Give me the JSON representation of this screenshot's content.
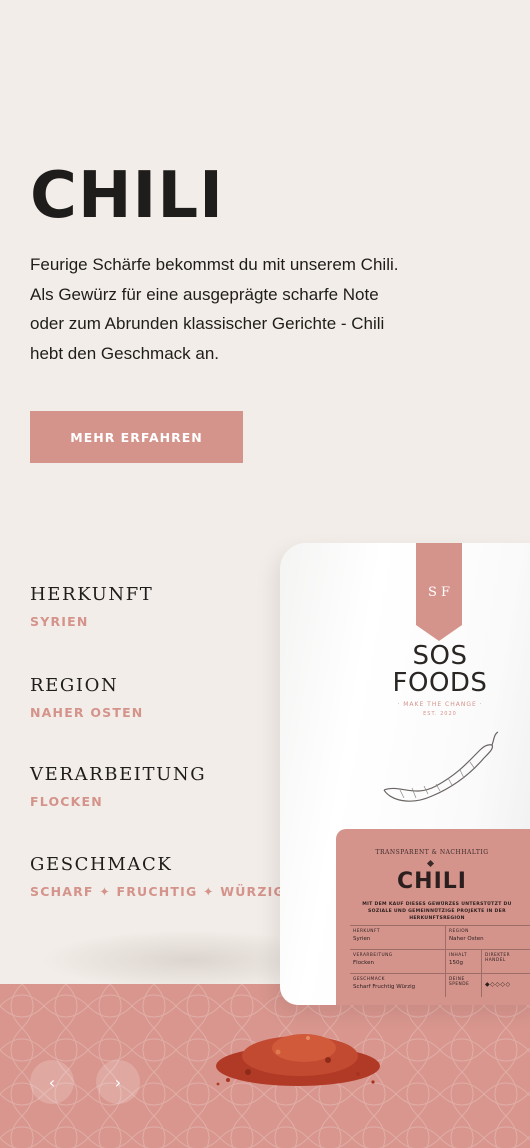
{
  "hero": {
    "title": "CHILI",
    "description_lines": [
      "Feurige Schärfe bekommst du mit unserem Chili.",
      "Als Gewürz für eine ausgeprägte scharfe Note",
      "oder zum Abrunden klassischer Gerichte - Chili",
      "hebt den Geschmack an."
    ],
    "cta_label": "MEHR ERFAHREN"
  },
  "attributes": [
    {
      "label": "HERKUNFT",
      "value": "SYRIEN"
    },
    {
      "label": "REGION",
      "value": "NAHER OSTEN"
    },
    {
      "label": "VERARBEITUNG",
      "value": "FLOCKEN"
    },
    {
      "label": "GESCHMACK",
      "value": "SCHARF ✦ FRUCHTIG ✦ WÜRZIG"
    }
  ],
  "pouch": {
    "monogram": "S F",
    "brand_line1": "SOS",
    "brand_line2": "FOODS",
    "tagline": "· MAKE THE CHANGE ·",
    "est": "EST. 2020",
    "panel_subtitle": "TRANSPARENT & NACHHALTIG",
    "panel_title": "CHILI",
    "panel_text": "MIT DEM KAUF DIESES GEWÜRZES UNTERSTÜTZT DU SOZIALE UND GEMEINNÜTZIGE PROJEKTE IN DER HERKUNFTSREGION",
    "specs": {
      "herkunft_k": "HERKUNFT",
      "herkunft_v": "Syrien",
      "region_k": "REGION",
      "region_v": "Naher Osten",
      "verarbeitung_k": "VERARBEITUNG",
      "verarbeitung_v": "Flocken",
      "inhalt_k": "INHALT",
      "inhalt_v": "150g",
      "handel_k": "DIREKTER HANDEL",
      "geschmack_k": "GESCHMACK",
      "geschmack_v": "Scharf  Fruchtig  Würzig",
      "spende_k": "DEINE SPENDE",
      "spende_rating": "◆◇◇◇◇"
    }
  },
  "nav": {
    "prev": "‹",
    "next": "›"
  },
  "colors": {
    "background": "#f2ede8",
    "accent": "#d4938b",
    "text": "#1f1d1b"
  },
  "icons": [
    "chevron-left-icon",
    "chevron-right-icon",
    "chili-pepper-icon",
    "diamond-icon"
  ]
}
